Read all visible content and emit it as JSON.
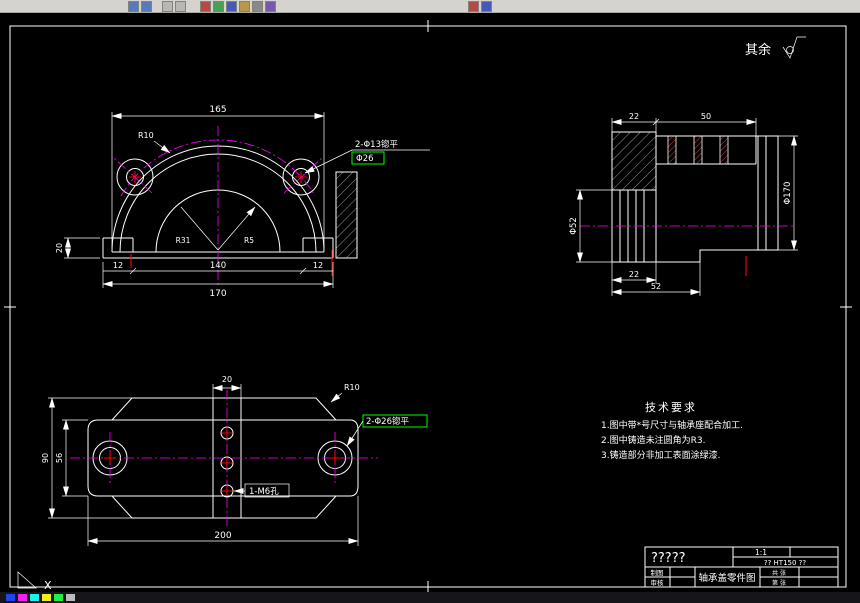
{
  "colors": {
    "canvas_bg": "#000000",
    "line": "#ffffff",
    "centerline": "#ff00ff",
    "mark": "#ff0000",
    "highlight": "#00ff00",
    "blue_text": "#5577ff",
    "red_text": "#ff4040"
  },
  "toolbar": {
    "icons": [
      "new-icon",
      "open-icon",
      "save-icon",
      "print-icon",
      "cut-icon",
      "copy-icon",
      "paste-icon",
      "undo-icon",
      "redo-icon",
      "layer-icon",
      "zoom-icon",
      "pan-icon"
    ]
  },
  "sheet": {
    "surplus_label": "其余"
  },
  "tech_requirements": {
    "title": "技术要求",
    "items": [
      "1.图中带*号尺寸与轴承座配合加工.",
      "2.图中铸造未注圆角为R3.",
      "3.铸造部分非加工表面涂绿漆."
    ]
  },
  "dims": {
    "front": {
      "top_width": "165",
      "left_thickness": "20",
      "seg_left": "12",
      "seg_mid": "140",
      "seg_right": "12",
      "base_total": "170",
      "note_line1": "2-Φ13锪平",
      "note_line2": "Φ26",
      "radius_note": "R10",
      "inner_left": "R31",
      "inner_right": "R5"
    },
    "side": {
      "top_left": "22",
      "top_right": "50",
      "right_dia": "Φ170",
      "left_dia": "Φ52",
      "bottom_a": "22",
      "bottom_b": "52"
    },
    "plan": {
      "radius_note": "R10",
      "hole_note": "2-Φ26锪平",
      "tap_note": "1-M6孔",
      "boss_width": "20",
      "bottom_total": "200",
      "left_inner": "56",
      "left_outer": "90"
    }
  },
  "title_block": {
    "part_name": "?????",
    "scale": "1:1",
    "material": "?? HT150 ??",
    "drawing_title": "轴承盖零件图",
    "role_draw": "制图",
    "role_check": "审核",
    "sheet_total": "共 张",
    "sheet_no": "第 张"
  },
  "ucs": {
    "x_label": "X"
  },
  "status": {
    "indicators": [
      "snap",
      "grid",
      "ortho",
      "polar",
      "osnap",
      "lwt"
    ]
  }
}
